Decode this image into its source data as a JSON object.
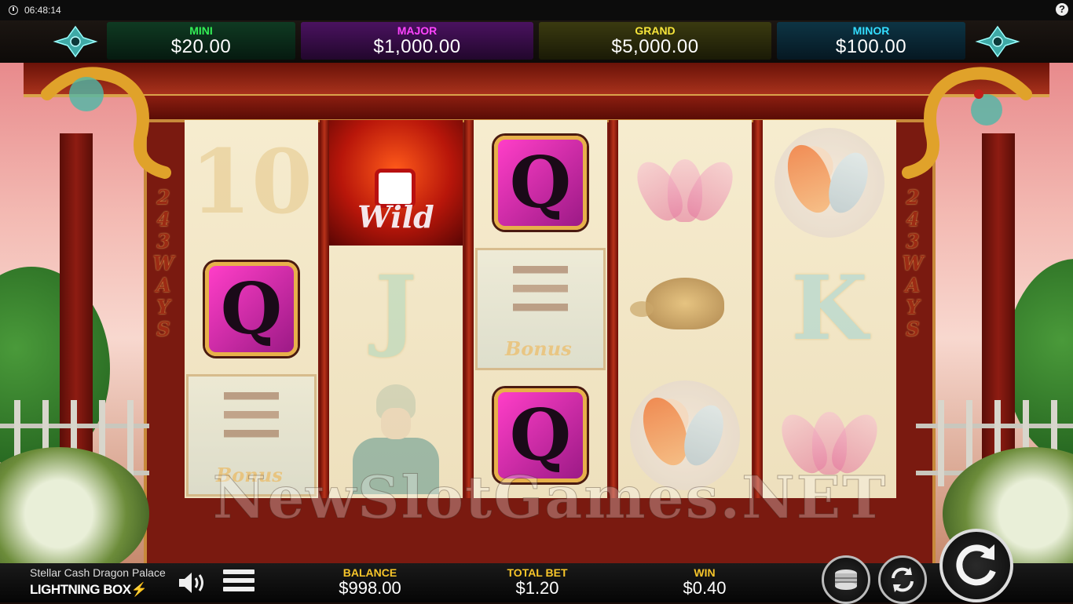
{
  "status": {
    "time": "06:48:14",
    "help": "?"
  },
  "jackpots": [
    {
      "label": "MINI",
      "amount": "$20.00"
    },
    {
      "label": "MAJOR",
      "amount": "$1,000.00"
    },
    {
      "label": "GRAND",
      "amount": "$5,000.00"
    },
    {
      "label": "MINOR",
      "amount": "$100.00"
    }
  ],
  "ways": {
    "left": [
      "2",
      "4",
      "3",
      "W",
      "A",
      "Y",
      "S"
    ],
    "right": [
      "2",
      "4",
      "3",
      "W",
      "A",
      "Y",
      "S"
    ]
  },
  "reels": [
    [
      "10",
      "Q",
      "Bonus"
    ],
    [
      "Wild",
      "J",
      "Warrior"
    ],
    [
      "Q",
      "Bonus",
      "Q"
    ],
    [
      "Lotus",
      "Turtle",
      "Koi"
    ],
    [
      "Koi",
      "K",
      "Lotus"
    ]
  ],
  "symbol_text": {
    "wild": "Wild",
    "bonus": "Bonus"
  },
  "watermark": "NewSlotGames.NET",
  "bottom": {
    "game_name": "Stellar Cash Dragon Palace",
    "logo_text": "LIGHTNING BOX",
    "balance_label": "BALANCE",
    "balance": "$998.00",
    "bet_label": "TOTAL BET",
    "bet": "$1.20",
    "win_label": "WIN",
    "win": "$0.40"
  },
  "colors": {
    "mini": "#33ee55",
    "major": "#ff44ff",
    "grand": "#f7e53a",
    "minor": "#33ddff",
    "label_gold": "#f7c52a"
  },
  "icons": [
    "clock-icon",
    "help-icon",
    "sound-icon",
    "menu-icon",
    "coins-icon",
    "autoplay-icon",
    "spin-icon",
    "lightning-bolt-icon"
  ]
}
